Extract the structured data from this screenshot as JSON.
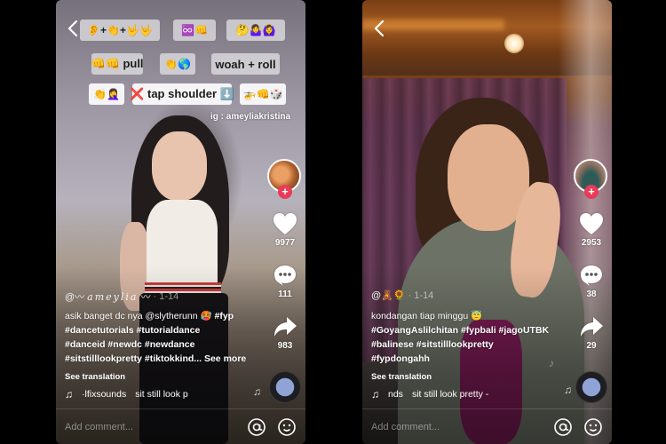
{
  "videos": [
    {
      "id": "left",
      "back_label": "‹",
      "stickers": [
        {
          "text": "👂+👏+🤟🤟"
        },
        {
          "text": "♾️👊"
        },
        {
          "text": "🤔🤷‍♀️🙆‍♀️"
        },
        {
          "text": "👊👊 pull"
        },
        {
          "text": "👏🌎"
        },
        {
          "text": "woah + roll"
        },
        {
          "text": "👏🤦‍♀️"
        },
        {
          "text": "❌ tap shoulder ⬇️"
        },
        {
          "text": "🚁👊🎲"
        }
      ],
      "overlay_text": "ig : ameyliakristina",
      "likes": "9977",
      "comments": "111",
      "shares": "983",
      "author_prefix": "@〰",
      "author_name": "ameylia",
      "author_suffix": "〰",
      "date": "· 1-14",
      "caption_text": "asik banget dc nya @slytherunn 🥵 ",
      "caption_lines": [
        "#fyp",
        "#dancetutorials #tutorialdance",
        "#danceid #newdc #newdance",
        "#sitstilllookpretty #tiktokkind..."
      ],
      "see_more": "See more",
      "see_translation": "See translation",
      "music_note": "♫",
      "music_author": "·lfixsounds",
      "music_title": "sit still look p",
      "comment_placeholder": "Add comment...",
      "colors": {
        "avatar": "#d27a3a",
        "avatar_bg": "#5a3b2a"
      }
    },
    {
      "id": "right",
      "back_label": "‹",
      "likes": "2953",
      "comments": "38",
      "shares": "29",
      "author_prefix": "@🧸🌻",
      "date": "· 1-14",
      "caption_text": "kondangan tiap minggu 😇",
      "caption_lines": [
        "#GoyangAslilchitan #fypbali #jagoUTBK",
        "#balinese #sitstilllookpretty",
        "#fypdongahh"
      ],
      "see_translation": "See translation",
      "music_note": "♫",
      "music_author": "nds",
      "music_title": "sit still look pretty -",
      "comment_placeholder": "Add comment...",
      "colors": {
        "avatar": "#2e5b57",
        "avatar_bg": "#a38a7a"
      }
    }
  ],
  "colors": {
    "follow_plus": "#ea3a57",
    "background": "#000000"
  }
}
